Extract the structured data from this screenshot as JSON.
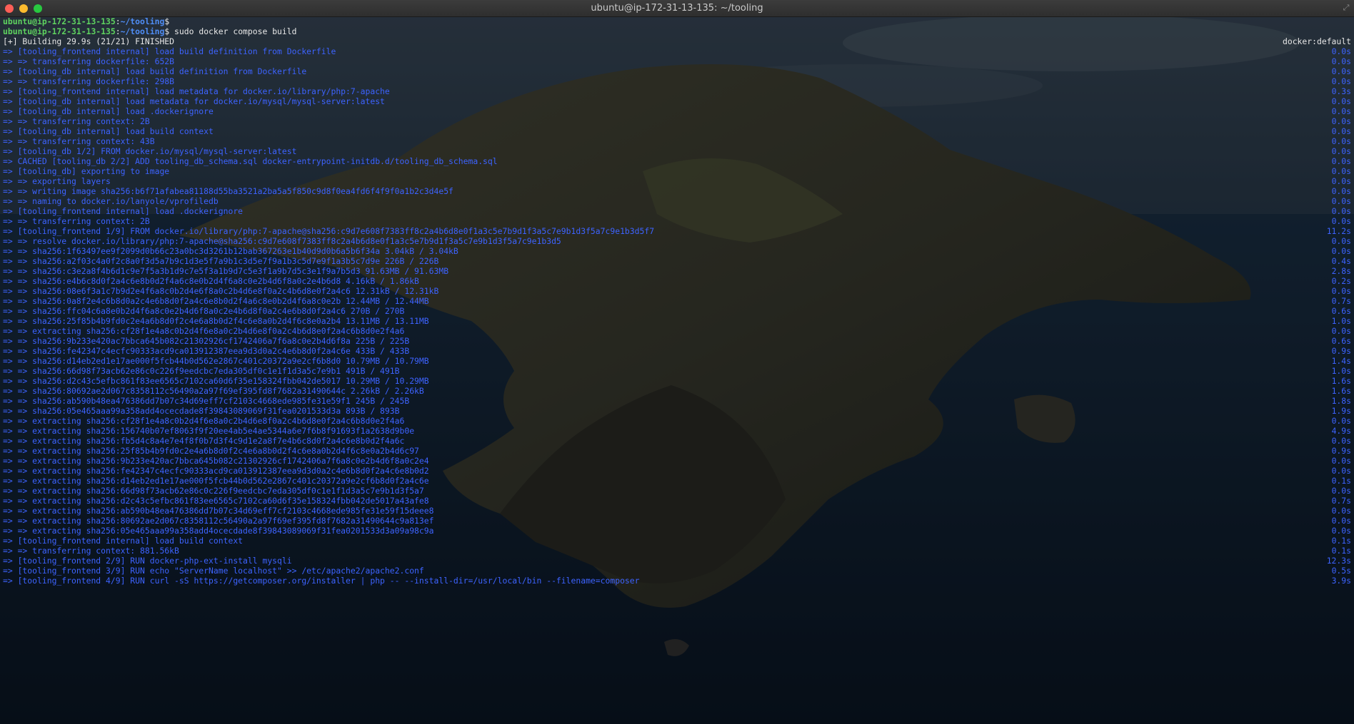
{
  "window": {
    "title": "ubuntu@ip-172-31-13-135: ~/tooling"
  },
  "prompt": {
    "user": "ubuntu@ip-172-31-13-135",
    "path": "~/tooling",
    "symbol": "$"
  },
  "commands": [
    "",
    "sudo docker compose build"
  ],
  "status": {
    "text": "[+] Building 29.9s (21/21) FINISHED",
    "right": "docker:default"
  },
  "build_lines": [
    {
      "text": "=> [tooling_frontend internal] load build definition from Dockerfile",
      "time": "0.0s"
    },
    {
      "text": "=> => transferring dockerfile: 652B",
      "time": "0.0s"
    },
    {
      "text": "=> [tooling_db internal] load build definition from Dockerfile",
      "time": "0.0s"
    },
    {
      "text": "=> => transferring dockerfile: 298B",
      "time": "0.0s"
    },
    {
      "text": "=> [tooling_frontend internal] load metadata for docker.io/library/php:7-apache",
      "time": "0.3s"
    },
    {
      "text": "=> [tooling_db internal] load metadata for docker.io/mysql/mysql-server:latest",
      "time": "0.0s"
    },
    {
      "text": "=> [tooling_db internal] load .dockerignore",
      "time": "0.0s"
    },
    {
      "text": "=> => transferring context: 2B",
      "time": "0.0s"
    },
    {
      "text": "=> [tooling_db internal] load build context",
      "time": "0.0s"
    },
    {
      "text": "=> => transferring context: 43B",
      "time": "0.0s"
    },
    {
      "text": "=> [tooling_db 1/2] FROM docker.io/mysql/mysql-server:latest",
      "time": "0.0s"
    },
    {
      "text": "=> CACHED [tooling_db 2/2] ADD tooling_db_schema.sql docker-entrypoint-initdb.d/tooling_db_schema.sql",
      "time": "0.0s"
    },
    {
      "text": "=> [tooling_db] exporting to image",
      "time": "0.0s"
    },
    {
      "text": "=> => exporting layers",
      "time": "0.0s"
    },
    {
      "text": "=> => writing image sha256:b6f71afabea81188d55ba3521a2ba5a5f850c9d8f0ea4fd6f4f9f0a1b2c3d4e5f",
      "time": "0.0s"
    },
    {
      "text": "=> => naming to docker.io/lanyole/vprofiledb",
      "time": "0.0s"
    },
    {
      "text": "=> [tooling_frontend internal] load .dockerignore",
      "time": "0.0s"
    },
    {
      "text": "=> => transferring context: 2B",
      "time": "0.0s"
    },
    {
      "text": "=> [tooling_frontend 1/9] FROM docker.io/library/php:7-apache@sha256:c9d7e608f7383ff8c2a4b6d8e0f1a3c5e7b9d1f3a5c7e9b1d3f5a7c9e1b3d5f7",
      "time": "11.2s"
    },
    {
      "text": "=> => resolve docker.io/library/php:7-apache@sha256:c9d7e608f7383ff8c2a4b6d8e0f1a3c5e7b9d1f3a5c7e9b1d3f5a7c9e1b3d5",
      "time": "0.0s"
    },
    {
      "text": "=> => sha256:1f63497ee9f2099d0b66c23a0bc3d3261b12bab367263e1b40d9d0b6a5b6f34a 3.04kB / 3.04kB",
      "time": "0.0s"
    },
    {
      "text": "=> => sha256:a2f03c4a0f2c8a0f3d5a7b9c1d3e5f7a9b1c3d5e7f9a1b3c5d7e9f1a3b5c7d9e 226B / 226B",
      "time": "0.4s"
    },
    {
      "text": "=> => sha256:c3e2a8f4b6d1c9e7f5a3b1d9c7e5f3a1b9d7c5e3f1a9b7d5c3e1f9a7b5d3 91.63MB / 91.63MB",
      "time": "2.8s"
    },
    {
      "text": "=> => sha256:e4b6c8d0f2a4c6e8b0d2f4a6c8e0b2d4f6a8c0e2b4d6f8a0c2e4b6d8 4.16kB / 1.86kB",
      "time": "0.2s"
    },
    {
      "text": "=> => sha256:08e6f3a1c7b9d2e4f6a8c0b2d4e6f8a0c2b4d6e8f0a2c4b6d8e0f2a4c6 12.31kB / 12.31kB",
      "time": "0.0s"
    },
    {
      "text": "=> => sha256:0a8f2e4c6b8d0a2c4e6b8d0f2a4c6e8b0d2f4a6c8e0b2d4f6a8c0e2b 12.44MB / 12.44MB",
      "time": "0.7s"
    },
    {
      "text": "=> => sha256:ffc04c6a8e0b2d4f6a8c0e2b4d6f8a0c2e4b6d8f0a2c4e6b8d0f2a4c6 270B / 270B",
      "time": "0.6s"
    },
    {
      "text": "=> => sha256:25f85b4b9fd0c2e4a6b8d0f2c4e6a8b0d2f4c6e8a0b2d4f6c8e0a2b4 13.11MB / 13.11MB",
      "time": "1.0s"
    },
    {
      "text": "=> => extracting sha256:cf28f1e4a8c0b2d4f6e8a0c2b4d6e8f0a2c4b6d8e0f2a4c6b8d0e2f4a6",
      "time": "0.0s"
    },
    {
      "text": "=> => sha256:9b233e420ac7bbca645b082c21302926cf1742406a7f6a8c0e2b4d6f8a 225B / 225B",
      "time": "0.6s"
    },
    {
      "text": "=> => sha256:fe42347c4ecfc90333acd9ca013912387eea9d3d0a2c4e6b8d0f2a4c6e 433B / 433B",
      "time": "0.9s"
    },
    {
      "text": "=> => sha256:d14eb2ed1e17ae000f5fcb44b0d562e2867c401c20372a9e2cf6b8d0 10.79MB / 10.79MB",
      "time": "1.4s"
    },
    {
      "text": "=> => sha256:66d98f73acb62e86c0c226f9eedcbc7eda305df0c1e1f1d3a5c7e9b1 491B / 491B",
      "time": "1.0s"
    },
    {
      "text": "=> => sha256:d2c43c5efbc861f83ee6565c7102ca60d6f35e158324fbb042de5017 10.29MB / 10.29MB",
      "time": "1.6s"
    },
    {
      "text": "=> => sha256:80692ae2d067c8358112c56490a2a97f69ef395fd8f7682a31490644c 2.26kB / 2.26kB",
      "time": "1.6s"
    },
    {
      "text": "=> => sha256:ab590b48ea476386dd7b07c34d69eff7cf2103c4668ede985fe31e59f1 245B / 245B",
      "time": "1.8s"
    },
    {
      "text": "=> => sha256:05e465aaa99a358add4ocecdade8f39843089069f31fea0201533d3a 893B / 893B",
      "time": "1.9s"
    },
    {
      "text": "=> => extracting sha256:cf28f1e4a8c0b2d4f6e8a0c2b4d6e8f0a2c4b6d8e0f2a4c6b8d0e2f4a6",
      "time": "0.0s"
    },
    {
      "text": "=> => extracting sha256:156740b07ef8063f9f20ee4ab5e4ae5344a6e7f6b8f91693f1a2638d9b0e",
      "time": "4.9s"
    },
    {
      "text": "=> => extracting sha256:fb5d4c8a4e7e4f8f0b7d3f4c9d1e2a8f7e4b6c8d0f2a4c6e8b0d2f4a6c",
      "time": "0.0s"
    },
    {
      "text": "=> => extracting sha256:25f85b4b9fd0c2e4a6b8d0f2c4e6a8b0d2f4c6e8a0b2d4f6c8e0a2b4d6c97",
      "time": "0.9s"
    },
    {
      "text": "=> => extracting sha256:9b233e420ac7bbca645b082c21302926cf1742406a7f6a8c0e2b4d6f8a0c2e4",
      "time": "0.0s"
    },
    {
      "text": "=> => extracting sha256:fe42347c4ecfc90333acd9ca013912387eea9d3d0a2c4e6b8d0f2a4c6e8b0d2",
      "time": "0.0s"
    },
    {
      "text": "=> => extracting sha256:d14eb2ed1e17ae000f5fcb44b0d562e2867c401c20372a9e2cf6b8d0f2a4c6e",
      "time": "0.1s"
    },
    {
      "text": "=> => extracting sha256:66d98f73acb62e86c0c226f9eedcbc7eda305df0c1e1f1d3a5c7e9b1d3f5a7",
      "time": "0.0s"
    },
    {
      "text": "=> => extracting sha256:d2c43c5efbc861f83ee6565c7102ca60d6f35e158324fbb042de5017a43afe8",
      "time": "0.7s"
    },
    {
      "text": "=> => extracting sha256:ab590b48ea476386dd7b07c34d69eff7cf2103c4668ede985fe31e59f15deee8",
      "time": "0.0s"
    },
    {
      "text": "=> => extracting sha256:80692ae2d067c8358112c56490a2a97f69ef395fd8f7682a31490644c9a813ef",
      "time": "0.0s"
    },
    {
      "text": "=> => extracting sha256:05e465aaa99a358add4ocecdade8f39843089069f31fea0201533d3a09a98c9a",
      "time": "0.0s"
    },
    {
      "text": "=> [tooling_frontend internal] load build context",
      "time": "0.1s"
    },
    {
      "text": "=> => transferring context: 881.56kB",
      "time": "0.1s"
    },
    {
      "text": "=> [tooling_frontend 2/9] RUN docker-php-ext-install mysqli",
      "time": "12.3s"
    },
    {
      "text": "=> [tooling_frontend 3/9] RUN echo \"ServerName localhost\" >> /etc/apache2/apache2.conf",
      "time": "0.5s"
    },
    {
      "text": "=> [tooling_frontend 4/9] RUN curl -sS https://getcomposer.org/installer | php -- --install-dir=/usr/local/bin --filename=composer",
      "time": "3.9s"
    }
  ]
}
